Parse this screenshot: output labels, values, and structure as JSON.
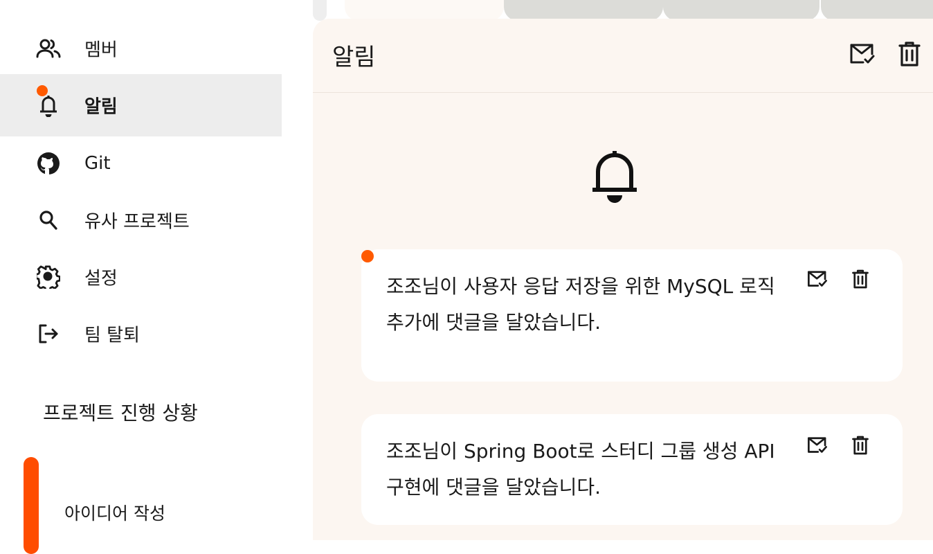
{
  "sidebar": {
    "items": [
      {
        "label": "멤버",
        "icon": "users-icon"
      },
      {
        "label": "알림",
        "icon": "bell-icon",
        "active": true,
        "has_unread": true
      },
      {
        "label": "Git",
        "icon": "github-icon"
      },
      {
        "label": "유사 프로젝트",
        "icon": "search-icon"
      },
      {
        "label": "설정",
        "icon": "gear-icon"
      },
      {
        "label": "팀 탈퇴",
        "icon": "logout-icon"
      }
    ],
    "progress": {
      "title": "프로젝트 진행 상황",
      "current_step": "아이디어 작성"
    }
  },
  "panel": {
    "title": "알림",
    "header_actions": [
      {
        "icon": "mark-all-read-icon"
      },
      {
        "icon": "trash-icon"
      }
    ],
    "empty_icon": "bell-icon",
    "notifications": [
      {
        "text": "조조님이 사용자 응답 저장을 위한 MySQL 로직 추가에 댓글을 달았습니다.",
        "unread": true
      },
      {
        "text": "조조님이 Spring Boot로 스터디 그룹 생성 API 구현에 댓글을 달았습니다.",
        "unread": false
      }
    ]
  },
  "colors": {
    "accent": "#ff5a00",
    "panel_bg": "#fcf6f1",
    "active_nav_bg": "#ededed"
  }
}
